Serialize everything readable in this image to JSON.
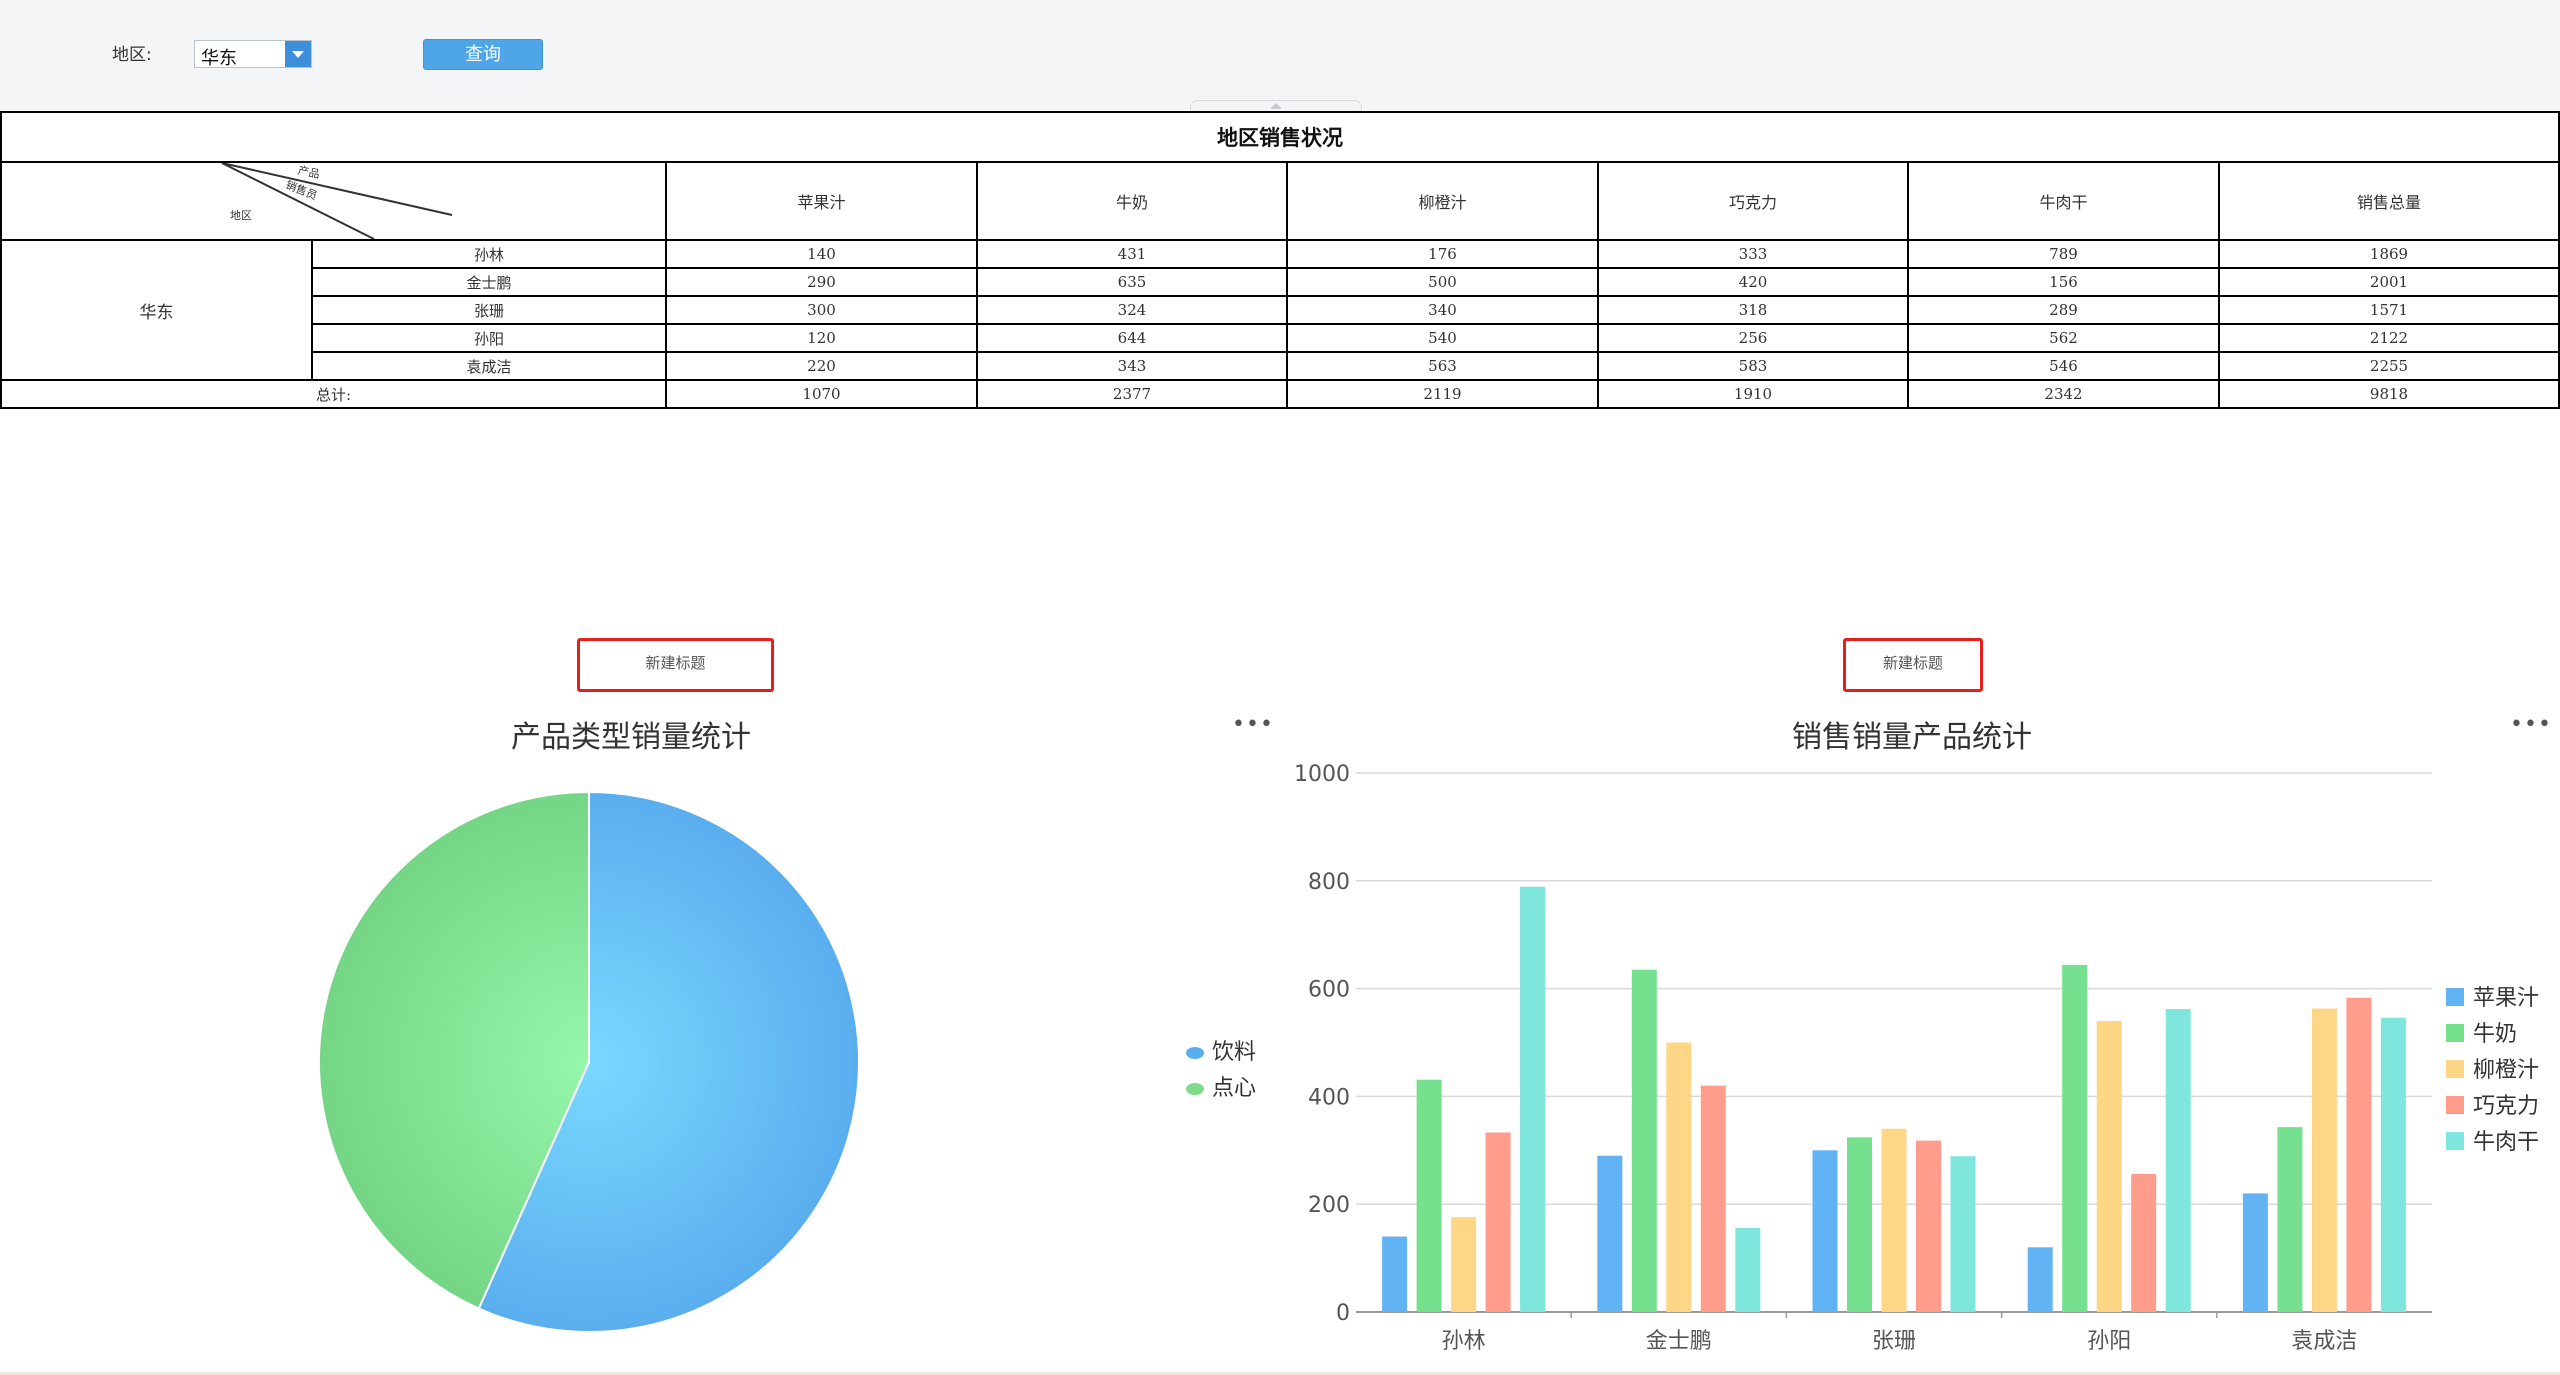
{
  "filter": {
    "region_label": "地区:",
    "region_value": "华东",
    "query_label": "查询"
  },
  "report": {
    "title": "地区销售状况",
    "corner_labels": {
      "product": "产品",
      "salesperson": "销售员",
      "region": "地区"
    },
    "columns": [
      "苹果汁",
      "牛奶",
      "柳橙汁",
      "巧克力",
      "牛肉干",
      "销售总量"
    ],
    "region": "华东",
    "rows": [
      {
        "name": "孙林",
        "values": [
          "140",
          "431",
          "176",
          "333",
          "789",
          "1869"
        ]
      },
      {
        "name": "金士鹏",
        "values": [
          "290",
          "635",
          "500",
          "420",
          "156",
          "2001"
        ]
      },
      {
        "name": "张珊",
        "values": [
          "300",
          "324",
          "340",
          "318",
          "289",
          "1571"
        ]
      },
      {
        "name": "孙阳",
        "values": [
          "120",
          "644",
          "540",
          "256",
          "562",
          "2122"
        ]
      },
      {
        "name": "袁成洁",
        "values": [
          "220",
          "343",
          "563",
          "583",
          "546",
          "2255"
        ]
      }
    ],
    "total_label": "总计:",
    "totals": [
      "1070",
      "2377",
      "2119",
      "1910",
      "2342",
      "9818"
    ]
  },
  "pie_panel": {
    "new_title": "新建标题",
    "more": "•••"
  },
  "bar_panel": {
    "new_title": "新建标题",
    "more": "•••"
  },
  "chart_data": [
    {
      "type": "pie",
      "title": "产品类型销量统计",
      "categories": [
        "饮料",
        "点心"
      ],
      "values": [
        5566,
        4252
      ],
      "colors": [
        "#5aaeee",
        "#7fdb8a"
      ],
      "legend_position": "right"
    },
    {
      "type": "bar",
      "title": "销售销量产品统计",
      "categories": [
        "孙林",
        "金士鹏",
        "张珊",
        "孙阳",
        "袁成洁"
      ],
      "series": [
        {
          "name": "苹果汁",
          "values": [
            140,
            290,
            300,
            120,
            220
          ],
          "color": "#62b3f3"
        },
        {
          "name": "牛奶",
          "values": [
            431,
            635,
            324,
            644,
            343
          ],
          "color": "#75e08d"
        },
        {
          "name": "柳橙汁",
          "values": [
            176,
            500,
            340,
            540,
            563
          ],
          "color": "#ffd685"
        },
        {
          "name": "巧克力",
          "values": [
            333,
            420,
            318,
            256,
            583
          ],
          "color": "#ff9c8c"
        },
        {
          "name": "牛肉干",
          "values": [
            789,
            156,
            289,
            562,
            546
          ],
          "color": "#7ee6dc"
        }
      ],
      "yticks": [
        "0",
        "200",
        "400",
        "600",
        "800",
        "1000"
      ],
      "ylim": [
        0,
        1000
      ],
      "grid": true,
      "legend_position": "right"
    }
  ]
}
